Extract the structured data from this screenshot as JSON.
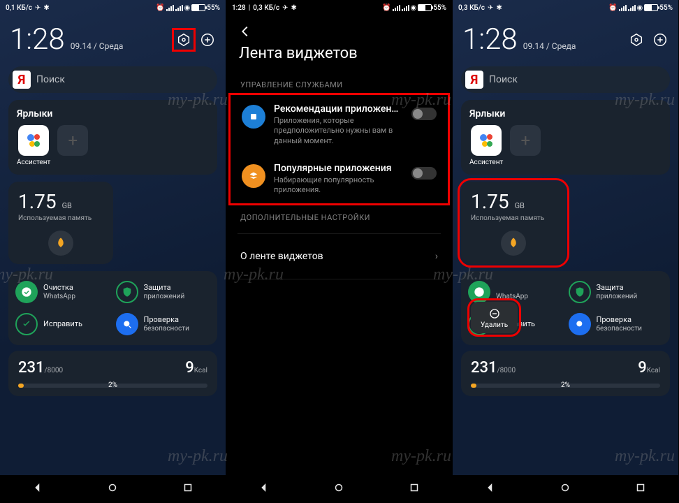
{
  "watermark": "my-pk.ru",
  "statusbar": {
    "data1": "0,1 КБ/с",
    "data2": "0,3 КБ/с",
    "data3": "0,3 КБ/с",
    "time2": "1:28",
    "battery_pct": "55%"
  },
  "home": {
    "time": "1:28",
    "date": "09.14 / Среда",
    "search_placeholder": "Поиск",
    "shortcuts_title": "Ярлыки",
    "assistant_label": "Ассистент",
    "memory": {
      "value": "1.75",
      "unit": "GB",
      "label": "Используемая память"
    },
    "security": {
      "whatsapp1": "Очистка",
      "whatsapp2": "WhatsApp",
      "protect1": "Защита",
      "protect2": "приложений",
      "fix": "Исправить",
      "scan1": "Проверка",
      "scan2": "безопасности"
    },
    "fitness": {
      "steps": "231",
      "steps_goal": "/8000",
      "kcal": "9",
      "kcal_unit": "Kcal",
      "pct": "2%"
    }
  },
  "settings": {
    "title": "Лента виджетов",
    "section1": "УПРАВЛЕНИЕ СЛУЖБАМИ",
    "rec_title": "Рекомендации приложен…",
    "rec_sub": "Приложения, которые предположительно нужны вам в данный момент.",
    "pop_title": "Популярные приложения",
    "pop_sub": "Набирающие популярность приложения.",
    "section2": "ДОПОЛНИТЕЛЬНЫЕ НАСТРОЙКИ",
    "about": "О ленте виджетов"
  },
  "popup": {
    "delete": "Удалить"
  }
}
